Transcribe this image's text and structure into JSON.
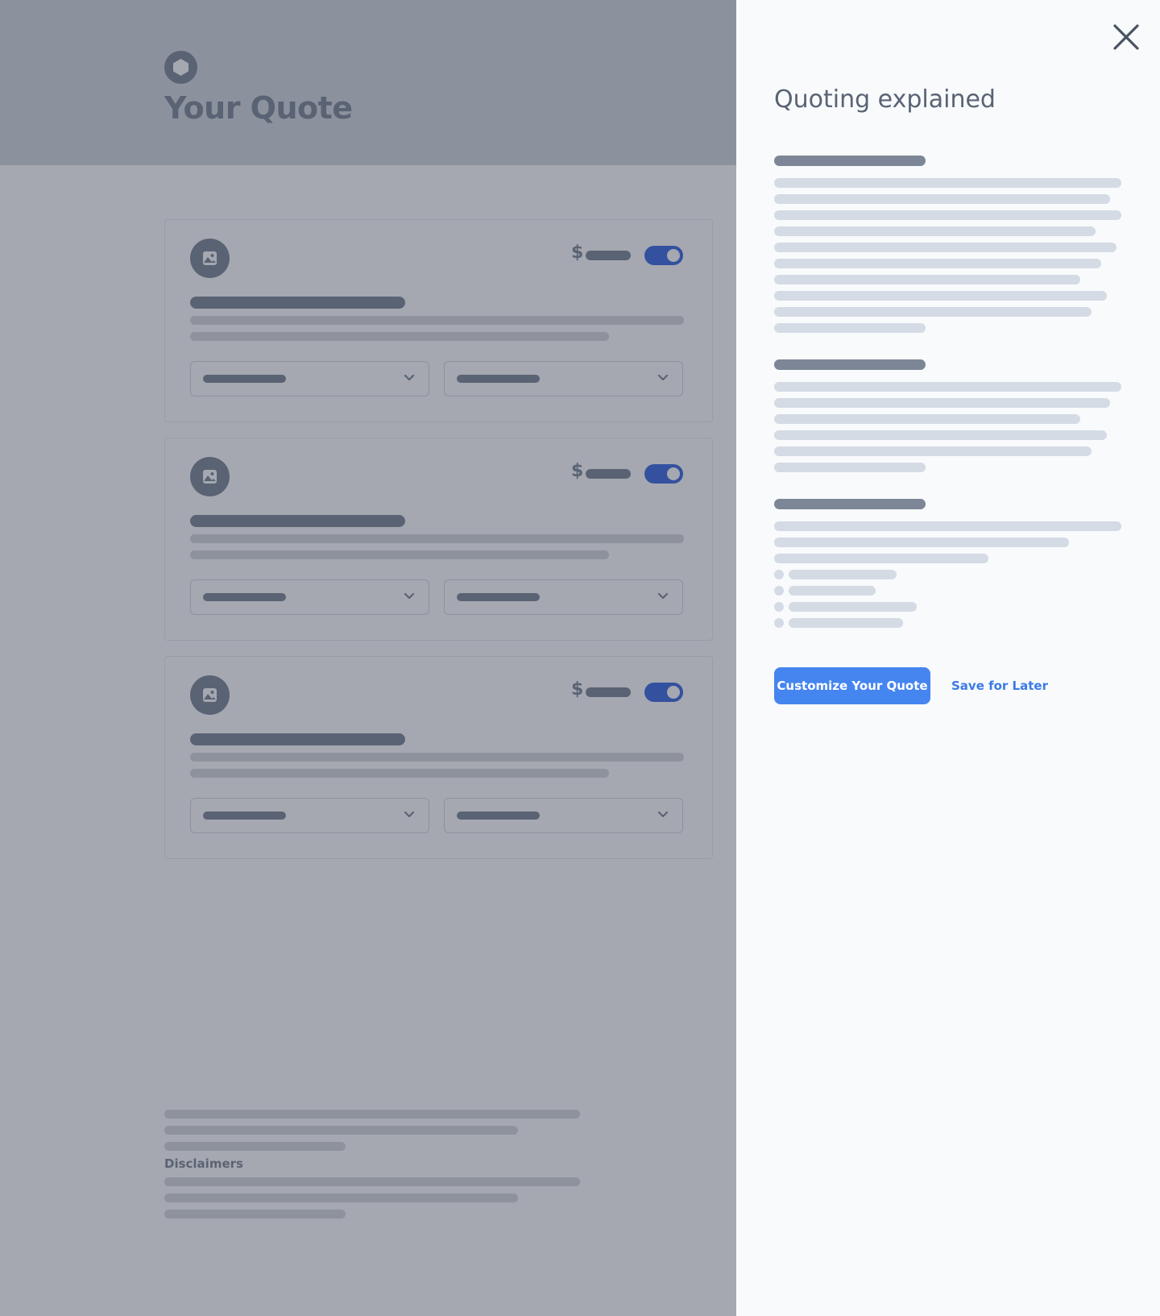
{
  "page": {
    "title": "Your Quote",
    "logo_icon": "hexagon-icon",
    "cards": [
      {
        "icon": "image-icon",
        "currency": "$",
        "toggle_on": true,
        "chevron_icon": "chevron-down-icon"
      },
      {
        "icon": "image-icon",
        "currency": "$",
        "toggle_on": true,
        "chevron_icon": "chevron-down-icon"
      },
      {
        "icon": "image-icon",
        "currency": "$",
        "toggle_on": true,
        "chevron_icon": "chevron-down-icon"
      }
    ],
    "disclaimers_label": "Disclaimers"
  },
  "drawer": {
    "close_icon": "close-icon",
    "title": "Quoting explained",
    "primary_button": "Customize Your Quote",
    "secondary_button": "Save for Later"
  },
  "colors": {
    "overlay_bg": "#a5a8b0",
    "header_bg": "#8c929d",
    "toggle_on": "#34519f",
    "primary": "#4585f0",
    "link": "#3b7ae6",
    "drawer_bg": "#f8fafc"
  }
}
